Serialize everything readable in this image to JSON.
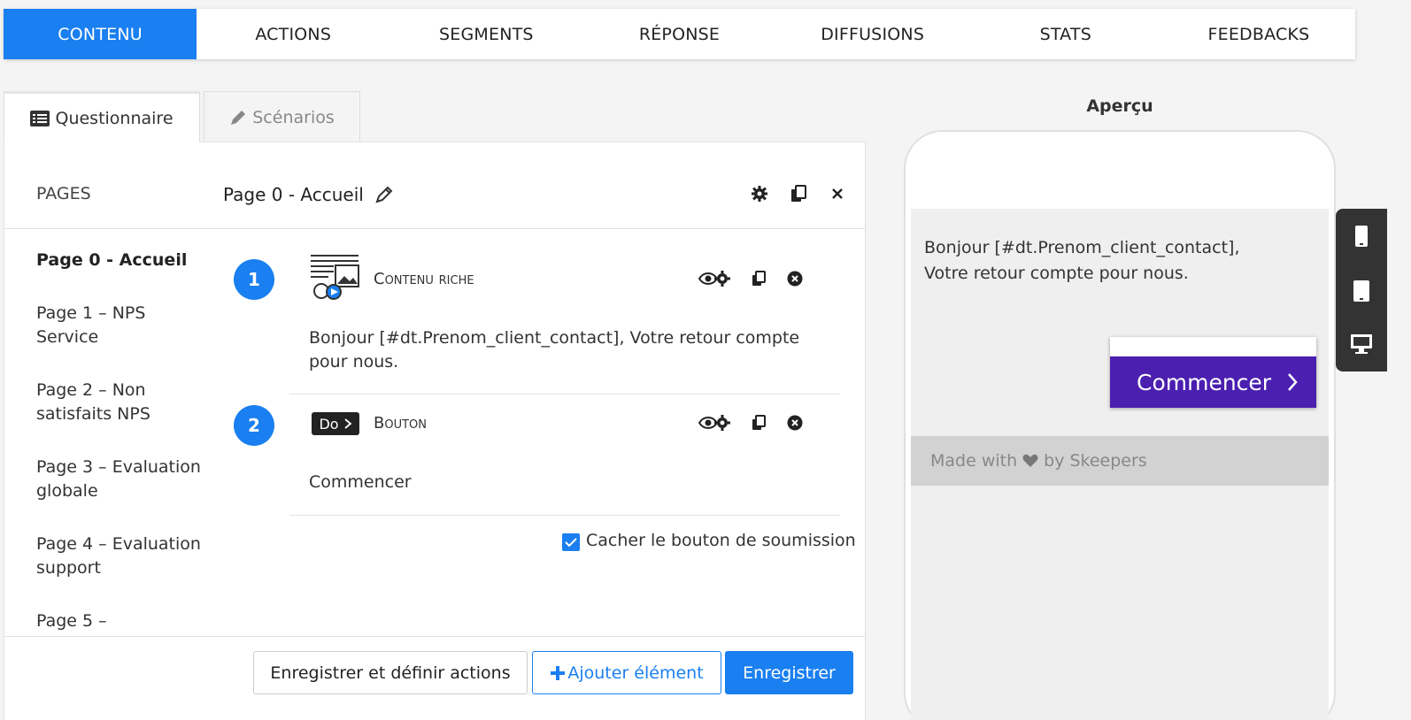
{
  "topnav": {
    "tabs": [
      {
        "label": "CONTENU",
        "active": true
      },
      {
        "label": "ACTIONS"
      },
      {
        "label": "SEGMENTS"
      },
      {
        "label": "RÉPONSE"
      },
      {
        "label": "DIFFUSIONS"
      },
      {
        "label": "STATS"
      },
      {
        "label": "FEEDBACKS"
      }
    ]
  },
  "subtabs": {
    "questionnaire": {
      "label": "Questionnaire",
      "icon": "list-icon"
    },
    "scenarios": {
      "label": "Scénarios",
      "icon": "pencil-icon"
    }
  },
  "panel": {
    "pages_label": "PAGES",
    "page_title": "Page 0 - Accueil",
    "header_icons": [
      "gear-icon",
      "copy-icon",
      "close-icon"
    ]
  },
  "sidebar": {
    "items": [
      {
        "label": "Page 0 - Accueil",
        "active": true
      },
      {
        "label": "Page 1 – NPS Service"
      },
      {
        "label": "Page 2 – Non satisfaits NPS"
      },
      {
        "label": "Page 3 – Evaluation globale"
      },
      {
        "label": "Page 4 – Evaluation support"
      },
      {
        "label": "Page 5 –"
      }
    ]
  },
  "elements": [
    {
      "number": "1",
      "type": "Contenu riche",
      "icon": "rich-content-icon",
      "content": "Bonjour [#dt.Prenom_client_contact], Votre retour compte pour nous."
    },
    {
      "number": "2",
      "type": "Bouton",
      "icon_text": "Do",
      "icon": "button-icon",
      "content": "Commencer"
    }
  ],
  "hide_submit": {
    "label": "Cacher le bouton de soumission",
    "checked": true
  },
  "footer_buttons": {
    "save_and_actions": "Enregistrer et définir actions",
    "add_element": "Ajouter élément",
    "save": "Enregistrer"
  },
  "preview": {
    "title": "Aperçu",
    "greeting_line1": "Bonjour [#dt.Prenom_client_contact],",
    "greeting_line2": "Votre retour compte pour nous.",
    "start_button": "Commencer",
    "footer_left": "Made with",
    "footer_right": "by Skeepers",
    "devices": [
      "mobile-icon",
      "tablet-icon",
      "desktop-icon"
    ]
  },
  "colors": {
    "accent": "#1a7ff0",
    "start_button": "#4b1fb0"
  }
}
